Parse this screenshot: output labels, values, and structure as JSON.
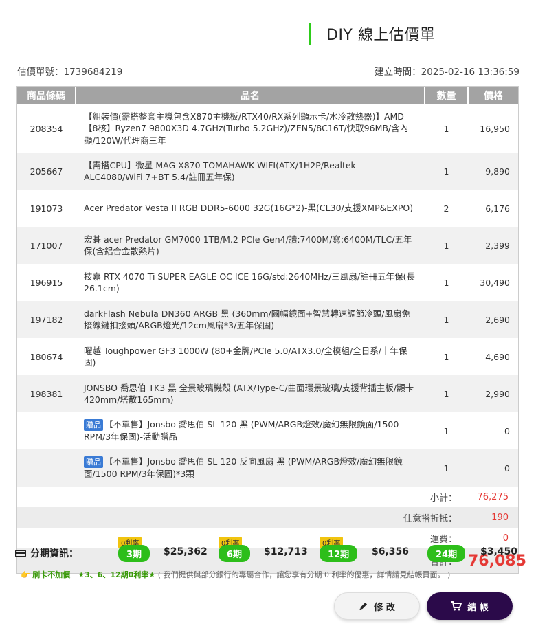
{
  "title": "DIY 線上估價單",
  "quote_no": "估價單號：1739684219",
  "created": "建立時間：2025-02-16 13:36:59",
  "columns": [
    "商品條碼",
    "品名",
    "數量",
    "價格"
  ],
  "items": [
    {
      "code": "208354",
      "name": "【組裝價(需搭整套主機包含X870主機板/RTX40/RX系列顯示卡/水冷散熱器)】AMD【8核】Ryzen7 9800X3D 4.7GHz(Turbo 5.2GHz)/ZEN5/8C16T/快取96MB/含內顯/120W/代理商三年",
      "qty": "1",
      "price": "16,950"
    },
    {
      "code": "205667",
      "name": "【需搭CPU】微星 MAG X870 TOMAHAWK WIFI(ATX/1H2P/Realtek ALC4080/WiFi 7+BT 5.4/註冊五年保)",
      "qty": "1",
      "price": "9,890"
    },
    {
      "code": "191073",
      "name": "Acer Predator Vesta II RGB DDR5-6000 32G(16G*2)-黑(CL30/支援XMP&EXPO)",
      "qty": "2",
      "price": "6,176"
    },
    {
      "code": "171007",
      "name": "宏碁 acer Predator GM7000 1TB/M.2 PCIe Gen4/讀:7400M/寫:6400M/TLC/五年保(含鋁合金散熱片)",
      "qty": "1",
      "price": "2,399"
    },
    {
      "code": "196915",
      "name": "技嘉 RTX 4070 Ti SUPER EAGLE OC ICE 16G/std:2640MHz/三風扇/註冊五年保(長26.1cm)",
      "qty": "1",
      "price": "30,490"
    },
    {
      "code": "197182",
      "name": "darkFlash Nebula DN360 ARGB 黑 (360mm/圓幅鏡面+智慧轉速調節冷頭/風扇免接線鏈扣接頭/ARGB燈光/12cm風扇*3/五年保固)",
      "qty": "1",
      "price": "2,690"
    },
    {
      "code": "180674",
      "name": "曜越 Toughpower GF3 1000W (80+金牌/PCIe 5.0/ATX3.0/全模組/全日系/十年保固)",
      "qty": "1",
      "price": "4,690"
    },
    {
      "code": "198381",
      "name": "JONSBO 喬思伯 TK3 黑 全景玻璃機殼 (ATX/Type-C/曲面環景玻璃/支援背插主板/顯卡420mm/塔散165mm)",
      "qty": "1",
      "price": "2,990"
    },
    {
      "code": "",
      "gift": "贈品",
      "name": "【不單售】Jonsbo 喬思伯 SL-120 黑 (PWM/ARGB燈效/魔幻無限鏡面/1500 RPM/3年保固)-活動贈品",
      "qty": "1",
      "price": "0"
    },
    {
      "code": "",
      "gift": "贈品",
      "name": "【不單售】Jonsbo 喬思伯 SL-120 反向風扇 黑 (PWM/ARGB燈效/魔幻無限鏡面/1500 RPM/3年保固)*3顆",
      "qty": "1",
      "price": "0"
    }
  ],
  "summary": {
    "subtotal_label": "小計：",
    "subtotal": "76,275",
    "discount_label": "仕意搭折抵：",
    "discount": "190",
    "shipping_label": "運費：",
    "shipping": "0",
    "total_label": "合計：",
    "total": "76,085"
  },
  "installments": {
    "title": "分期資訊：",
    "plans": [
      {
        "rate": "0利率",
        "term": "3期",
        "amount": "$25,362"
      },
      {
        "rate": "0利率",
        "term": "6期",
        "amount": "$12,713"
      },
      {
        "rate": "0利率",
        "term": "12期",
        "amount": "$6,356"
      },
      {
        "rate": "",
        "term": "24期",
        "amount": "$3,450"
      }
    ]
  },
  "note": {
    "emoji": "👉",
    "highlight": "刷卡不加價　★3、6、12期0利率★",
    "text": "( 我們提供與部分銀行的專屬合作，讓您享有分期 0 利率的優惠，詳情請見結帳頁面。 )"
  },
  "buttons": {
    "edit": "修 改",
    "checkout": "結 帳"
  },
  "colors": {
    "accent_green": "#2dbe1a",
    "price_red": "#e53935",
    "checkout_purple": "#2b0a4a",
    "rate_yellow": "#f1c40f"
  }
}
